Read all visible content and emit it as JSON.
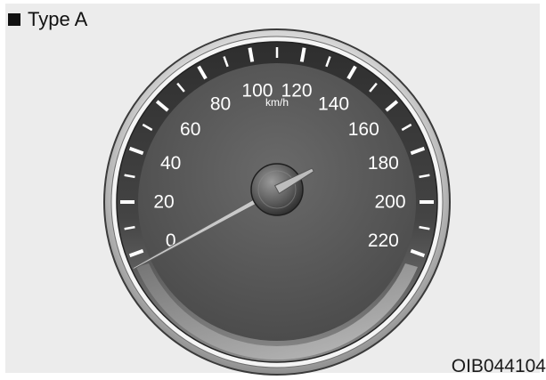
{
  "heading": {
    "bullet_icon": "black-square-icon",
    "text": "Type A"
  },
  "gauge": {
    "unit": "km/h",
    "scale_labels": [
      "0",
      "20",
      "40",
      "60",
      "80",
      "100",
      "120",
      "140",
      "160",
      "180",
      "200",
      "220"
    ],
    "scale_min": 0,
    "scale_max": 220,
    "needle_value": 0,
    "colors": {
      "dial_face": "#5c5c5c",
      "tick_band": "#3a3a3a",
      "bezel": "#b9b9b9",
      "markings": "#ffffff"
    }
  },
  "image_code": "OIB044104"
}
